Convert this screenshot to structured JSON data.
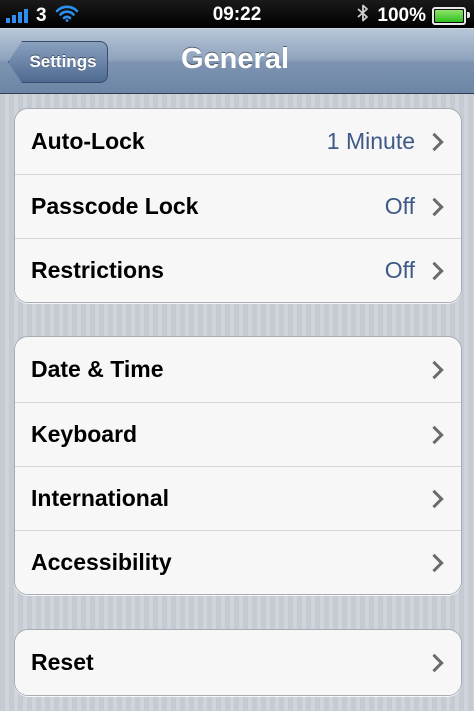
{
  "status_bar": {
    "carrier": "3",
    "time": "09:22",
    "battery_percent": "100%",
    "battery_level": 1.0,
    "signal_bars": 4,
    "icons": [
      "signal-bars-icon",
      "wifi-icon",
      "bluetooth-icon",
      "battery-icon"
    ]
  },
  "nav": {
    "back_label": "Settings",
    "title": "General"
  },
  "groups": [
    [
      {
        "label": "Auto-Lock",
        "value": "1 Minute"
      },
      {
        "label": "Passcode Lock",
        "value": "Off"
      },
      {
        "label": "Restrictions",
        "value": "Off"
      }
    ],
    [
      {
        "label": "Date & Time",
        "value": ""
      },
      {
        "label": "Keyboard",
        "value": ""
      },
      {
        "label": "International",
        "value": ""
      },
      {
        "label": "Accessibility",
        "value": ""
      }
    ],
    [
      {
        "label": "Reset",
        "value": ""
      }
    ]
  ],
  "colors": {
    "nav_bar": "#7d94b1",
    "value_text": "#3d5a86",
    "background": "#c9ced6",
    "signal": "#2e8ff0",
    "battery_fill": "#2fbf1f"
  }
}
